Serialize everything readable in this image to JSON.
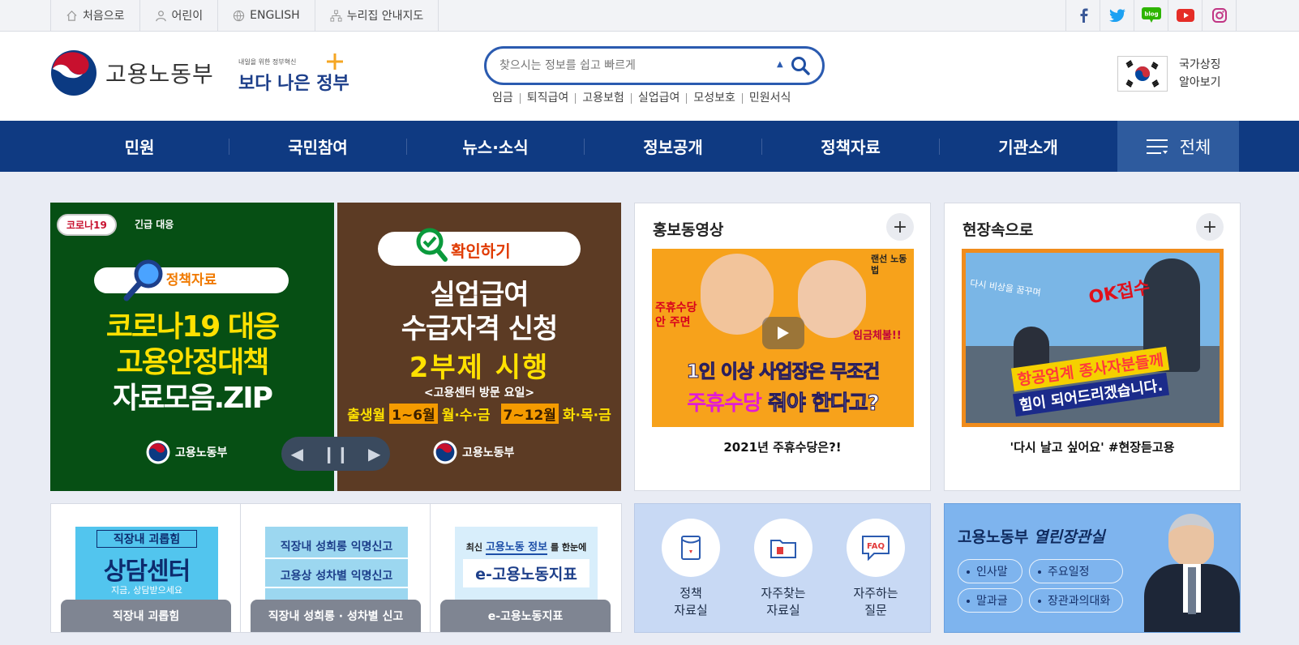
{
  "topbar": {
    "links": [
      {
        "label": "처음으로",
        "icon": "home-icon"
      },
      {
        "label": "어린이",
        "icon": "person-icon"
      },
      {
        "label": "ENGLISH",
        "icon": "globe-icon"
      },
      {
        "label": "누리집 안내지도",
        "icon": "sitemap-icon"
      }
    ],
    "sns": [
      "facebook-icon",
      "twitter-icon",
      "blog-icon",
      "youtube-icon",
      "instagram-icon"
    ]
  },
  "header": {
    "logo_text": "고용노동부",
    "gov_small": "내일을 위한 정부혁신",
    "gov_big": "보다 나은 정부",
    "search_placeholder": "찾으시는 정보를 쉽고 빠르게",
    "keywords": [
      "임금",
      "퇴직급여",
      "고용보험",
      "실업급여",
      "모성보호",
      "민원서식"
    ],
    "symbol_line1": "국가상징",
    "symbol_line2": "알아보기"
  },
  "gnb": {
    "items": [
      "민원",
      "국민참여",
      "뉴스·소식",
      "정보공개",
      "정책자료",
      "기관소개"
    ],
    "all_label": "전체"
  },
  "banner1": {
    "badge": "코로나19",
    "badge_suffix": "긴급 대응",
    "tag": "정책자료",
    "line1": "코로나19 대응",
    "line2": "고용안정대책",
    "line3": "자료모음.ZIP",
    "org": "고용노동부"
  },
  "banner2": {
    "tag": "확인하기",
    "line1": "실업급여",
    "line2": "수급자격 신청",
    "line3": "2부제 시행",
    "sub": "<고용센터 방문 요일>",
    "d1": "출생월",
    "d2": "1~6월",
    "d3": "월·수·금",
    "d4": "7~12월",
    "d5": "화·목·금",
    "org": "고용노동부"
  },
  "video": {
    "title": "홍보동영상",
    "caption": "2021년 주휴수당은?!",
    "thumb_line1": "1인 이상 사업장은 무조건",
    "thumb_line2a": "주휴수당",
    "thumb_line2b": "줘야 한다고?",
    "thumb_left": "주휴수당 안 주면",
    "thumb_right": "임금체불!!",
    "thumb_badge": "랜선 노동법"
  },
  "field": {
    "title": "현장속으로",
    "caption": "'다시 날고 싶어요' #현장듣고용",
    "thumb_top": "다시 비상을 꿈꾸며",
    "thumb_ok": "OK접수",
    "thumb_line1": "항공업계 종사자분들께",
    "thumb_line2": "힘이 되어드리겠습니다."
  },
  "quick": [
    {
      "box_top": "직장내 괴롭힘",
      "box_big": "상담센터",
      "box_sub": "지금, 상담받으세요",
      "button": "직장내 괴롭힘"
    },
    {
      "box_top": "직장내 성희롱 익명신고",
      "box_big": "고용상 성차별 익명신고",
      "button": "직장내 성희롱 · 성차별 신고"
    },
    {
      "box_top1": "최신",
      "box_top2": "고용노동 정보",
      "box_top3": "를 한눈에",
      "box_big": "e-고용노동지표",
      "button": "e-고용노동지표"
    }
  ],
  "qlinks": [
    {
      "l1": "정책",
      "l2": "자료실",
      "icon": "book-icon"
    },
    {
      "l1": "자주찾는",
      "l2": "자료실",
      "icon": "folder-icon"
    },
    {
      "l1": "자주하는",
      "l2": "질문",
      "icon": "faq-icon"
    }
  ],
  "minister": {
    "title_a": "고용노동부",
    "title_b": "열린장관실",
    "pills": [
      "인사말",
      "주요일정",
      "말과글",
      "장관과의대화"
    ]
  },
  "banner_controls": {
    "prev": "◀",
    "pause": "❙❙",
    "next": "▶"
  },
  "colors": {
    "navy": "#0f3a82",
    "accent": "#2e5b9e"
  }
}
